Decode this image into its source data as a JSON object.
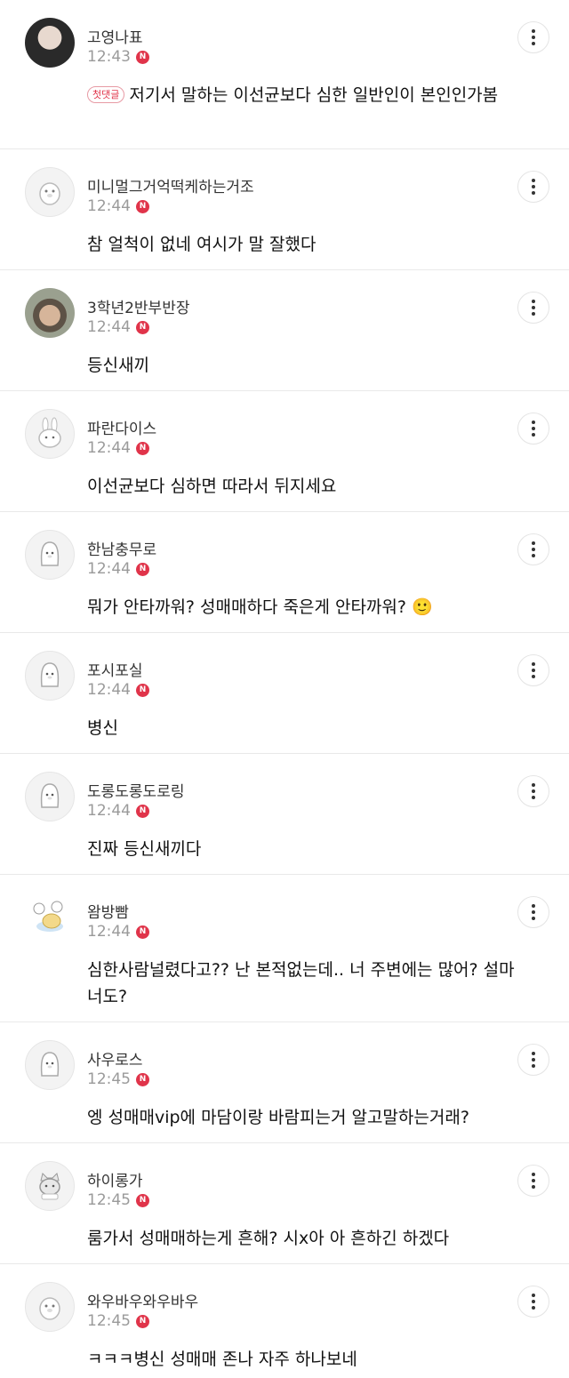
{
  "comments": [
    {
      "nickname": "고영나표",
      "time": "12:43",
      "badge": "N",
      "first_tag": "첫댓글",
      "text": "저기서 말하는 이선균보다 심한 일반인이 본인인가봄",
      "avatar": "photo-dark"
    },
    {
      "nickname": "미니멀그거억떡케하는거조",
      "time": "12:44",
      "badge": "N",
      "text": "참 얼척이 없네 여시가 말 잘했다",
      "avatar": "default-character"
    },
    {
      "nickname": "3학년2반부반장",
      "time": "12:44",
      "badge": "N",
      "text": "등신새끼",
      "avatar": "photo-kid"
    },
    {
      "nickname": "파란다이스",
      "time": "12:44",
      "badge": "N",
      "text": "이선균보다 심하면 따라서 뒤지세요",
      "avatar": "rabbit-character"
    },
    {
      "nickname": "한남충무로",
      "time": "12:44",
      "badge": "N",
      "text": "뭐가 안타까워? 성매매하다 죽은게 안타까워? 🙂",
      "avatar": "penguin-character"
    },
    {
      "nickname": "포시포실",
      "time": "12:44",
      "badge": "N",
      "text": "병신",
      "avatar": "penguin-character"
    },
    {
      "nickname": "도롱도롱도로링",
      "time": "12:44",
      "badge": "N",
      "text": "진짜 등신새끼다",
      "avatar": "penguin-character"
    },
    {
      "nickname": "왐방빰",
      "time": "12:44",
      "badge": "N",
      "text": "심한사람널렸다고?? 난 본적없는데.. 너 주변에는 많어? 설마너도?",
      "avatar": "photo-sticker"
    },
    {
      "nickname": "사우로스",
      "time": "12:45",
      "badge": "N",
      "text": "엥 성매매vip에 마담이랑 바람피는거 알고말하는거래?",
      "avatar": "penguin-character"
    },
    {
      "nickname": "하이롱가",
      "time": "12:45",
      "badge": "N",
      "text": "룸가서 성매매하는게 흔해? 시x아 아 흔하긴 하겠다",
      "avatar": "cat-character"
    },
    {
      "nickname": "와우바우와우바우",
      "time": "12:45",
      "badge": "N",
      "text": "ㅋㅋㅋ병신 성매매 존나 자주 하나보네",
      "avatar": "default-character"
    }
  ],
  "more_icon": "vertical-dots-icon",
  "colors": {
    "badge": "#e0344a",
    "time": "#9a9a9a",
    "divider": "#e9e9e9"
  }
}
